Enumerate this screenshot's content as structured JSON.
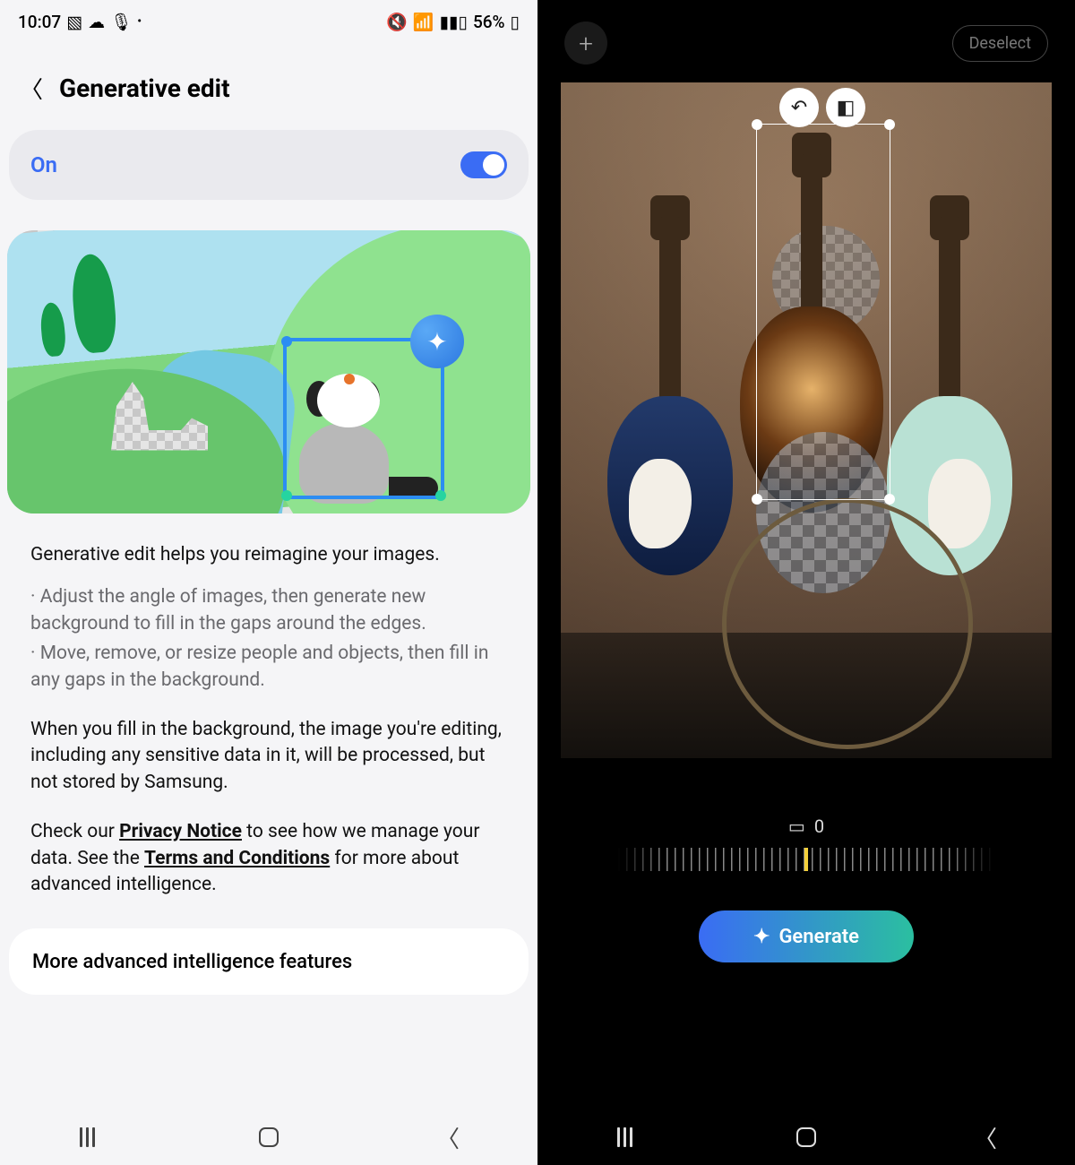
{
  "left": {
    "status": {
      "time": "10:07",
      "battery": "56%"
    },
    "header": {
      "title": "Generative edit"
    },
    "toggle": {
      "label": "On",
      "state": true
    },
    "desc": {
      "lead": "Generative edit helps you reimagine your images.",
      "bullet1": "· Adjust the angle of images, then generate new background to fill in the gaps around the edges.",
      "bullet2": "· Move, remove, or resize people and objects, then fill in any gaps in the background.",
      "para2": "When you fill in the background, the image you're editing, including any sensitive data in it, will be processed, but not stored by Samsung.",
      "para3a": "Check our ",
      "privacy": "Privacy Notice",
      "para3b": " to see how we manage your data. See the ",
      "terms": "Terms and Conditions",
      "para3c": " for more about advanced intelligence."
    },
    "more": "More advanced intelligence features"
  },
  "right": {
    "deselect": "Deselect",
    "angle": "0",
    "generate": "Generate"
  }
}
